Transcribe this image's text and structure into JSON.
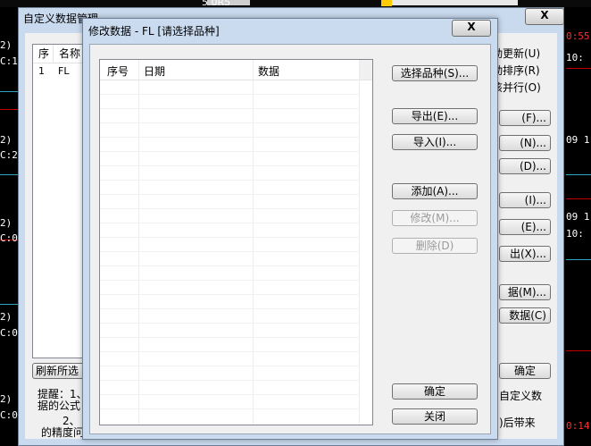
{
  "background": {
    "top_label": "5 0R5",
    "left_texts": [
      "2)",
      "C:1",
      "2)",
      "C:2",
      "2)",
      "C:0",
      "2)",
      "C:0",
      "2)",
      "C:0"
    ],
    "right_texts": [
      "0:55",
      "10:",
      "09 1",
      "09 1",
      "10:",
      "0:14"
    ]
  },
  "outer_window": {
    "title": "自定义数据管理",
    "close_label": "X",
    "list_headers": [
      "序",
      "名称"
    ],
    "list_rows": [
      [
        "1",
        "FL"
      ]
    ],
    "right_labels": [
      "动更新(U)",
      "动排序(R)",
      "该并行(O)"
    ],
    "buttons": [
      "(F)...",
      "(N)...",
      "(D)...",
      "(I)...",
      "(E)...",
      "出(X)...",
      "据(M)...",
      "数据(C)",
      "确定"
    ],
    "refresh_button": "刷新所选",
    "note_line1": "提醒：1、",
    "note_line2": "据的公式",
    "note_line3": "2、",
    "note_line4": "的精度问",
    "note_right1": "自定义数",
    "note_right2": ")后带来"
  },
  "dialog": {
    "title": "修改数据 - FL [请选择品种]",
    "close_label": "X",
    "columns": [
      "序号",
      "日期",
      "数据"
    ],
    "buttons": {
      "select_variety": "选择品种(S)...",
      "export": "导出(E)...",
      "import": "导入(I)...",
      "add": "添加(A)...",
      "modify": "修改(M)...",
      "delete": "删除(D)",
      "ok": "确定",
      "close": "关闭"
    }
  },
  "colors": {
    "titlebar": "#c9d9ee",
    "dialog_bg": "#f0f0f0",
    "bg_red": "#c00000",
    "bg_cyan": "#2fa3c8"
  }
}
